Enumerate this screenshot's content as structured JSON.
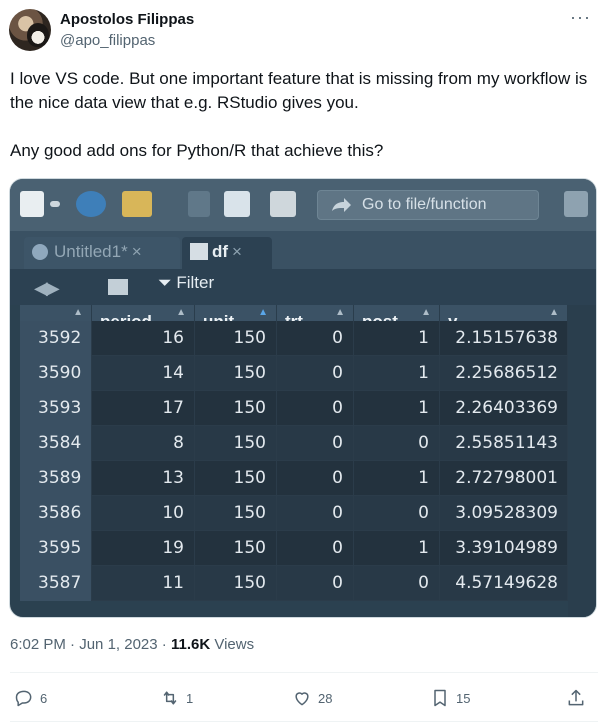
{
  "author": {
    "name": "Apostolos Filippas",
    "handle": "@apo_filippas"
  },
  "tweet": {
    "paragraph1": "I love VS code. But one important feature that is missing from my workflow is the nice data view that e.g. RStudio gives you.",
    "paragraph2": "Any good add ons for Python/R that achieve this?"
  },
  "rstudio": {
    "goto_label": "Go to file/function",
    "tabs": [
      {
        "label": "Untitled1*"
      },
      {
        "label": "df"
      }
    ],
    "tab_close": "×",
    "filter_label": "Filter",
    "columns": [
      "",
      "period",
      "unit",
      "trt",
      "post",
      "y"
    ],
    "rows": [
      [
        "3592",
        "16",
        "150",
        "0",
        "1",
        "2.15157638"
      ],
      [
        "3590",
        "14",
        "150",
        "0",
        "1",
        "2.25686512"
      ],
      [
        "3593",
        "17",
        "150",
        "0",
        "1",
        "2.26403369"
      ],
      [
        "3584",
        "8",
        "150",
        "0",
        "0",
        "2.55851143"
      ],
      [
        "3589",
        "13",
        "150",
        "0",
        "1",
        "2.72798001"
      ],
      [
        "3586",
        "10",
        "150",
        "0",
        "0",
        "3.09528309"
      ],
      [
        "3595",
        "19",
        "150",
        "0",
        "1",
        "3.39104989"
      ],
      [
        "3587",
        "11",
        "150",
        "0",
        "0",
        "4.57149628"
      ]
    ]
  },
  "meta": {
    "time": "6:02 PM",
    "date": "Jun 1, 2023",
    "views_count": "11.6K",
    "views_label": "Views"
  },
  "actions": {
    "replies": "6",
    "reposts": "1",
    "likes": "28",
    "bookmarks": "15"
  },
  "icons": [
    "more-icon",
    "reply-icon",
    "repost-icon",
    "like-icon",
    "bookmark-icon",
    "share-icon"
  ]
}
